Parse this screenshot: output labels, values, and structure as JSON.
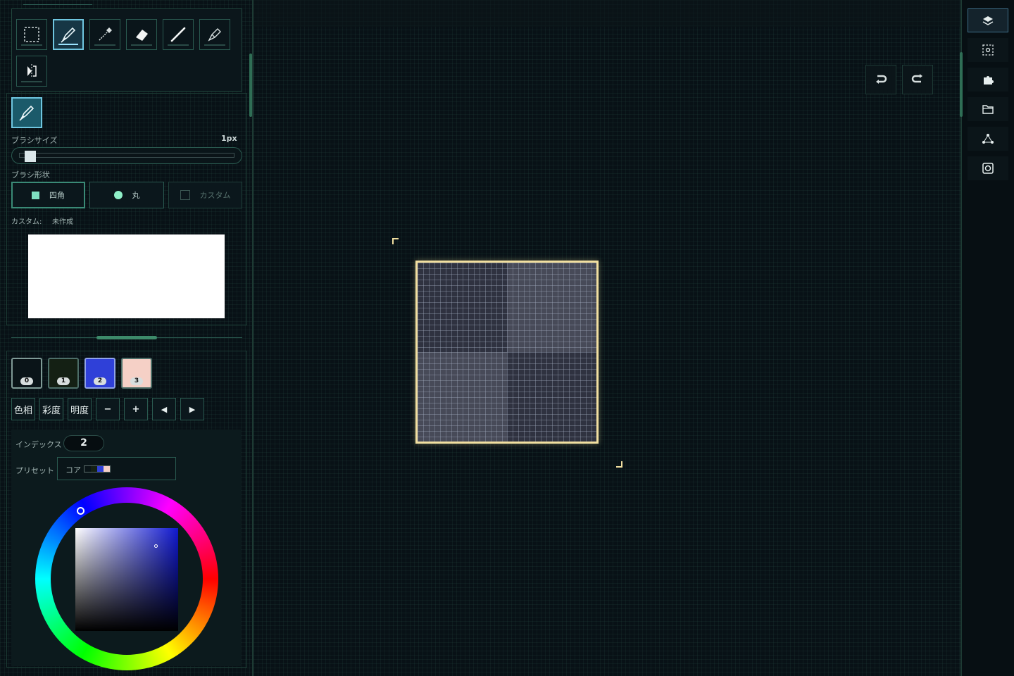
{
  "tools": [
    {
      "name": "select-tool",
      "icon": "dashed-rect-icon"
    },
    {
      "name": "pen-tool",
      "icon": "pen-icon",
      "active": true
    },
    {
      "name": "eyedropper-tool",
      "icon": "eyedropper-icon"
    },
    {
      "name": "eraser-tool",
      "icon": "eraser-icon"
    },
    {
      "name": "line-tool",
      "icon": "line-icon"
    },
    {
      "name": "fill-tool",
      "icon": "bucket-icon"
    },
    {
      "name": "mirror-tool",
      "icon": "mirror-icon"
    }
  ],
  "brush": {
    "size_label": "ブラシサイズ",
    "size_value": "1px",
    "size_fraction": 0.02,
    "shape_label": "ブラシ形状",
    "shapes": [
      {
        "label": "四角",
        "active": true
      },
      {
        "label": "丸",
        "active": false
      },
      {
        "label": "カスタム",
        "active": false
      }
    ],
    "custom_label": "カスタム:",
    "custom_status": "未作成"
  },
  "palette": {
    "swatches": [
      {
        "index": "0",
        "color": "#0a1418"
      },
      {
        "index": "1",
        "color": "#142014"
      },
      {
        "index": "2",
        "color": "#2f40d8"
      },
      {
        "index": "3",
        "color": "#f5d0c6"
      }
    ],
    "buttons": [
      "色相",
      "彩度",
      "明度",
      "−",
      "+",
      "◀",
      "▶"
    ],
    "index_label": "インデックス",
    "index_value": "2",
    "preset_label": "プリセット",
    "preset_value": "コア"
  },
  "colors": {
    "accent": "#3a8a76",
    "canvas_border": "#f1dfa0",
    "active_tool": "#6fc6e0"
  },
  "right_panel": {
    "items": [
      {
        "name": "layers-button",
        "icon": "layers-icon",
        "active": true
      },
      {
        "name": "selection-button",
        "icon": "selection-icon"
      },
      {
        "name": "plugin-button",
        "icon": "puzzle-icon"
      },
      {
        "name": "folder-button",
        "icon": "folder-icon"
      },
      {
        "name": "nodes-button",
        "icon": "nodes-icon"
      },
      {
        "name": "camera-button",
        "icon": "camera-icon"
      }
    ]
  }
}
